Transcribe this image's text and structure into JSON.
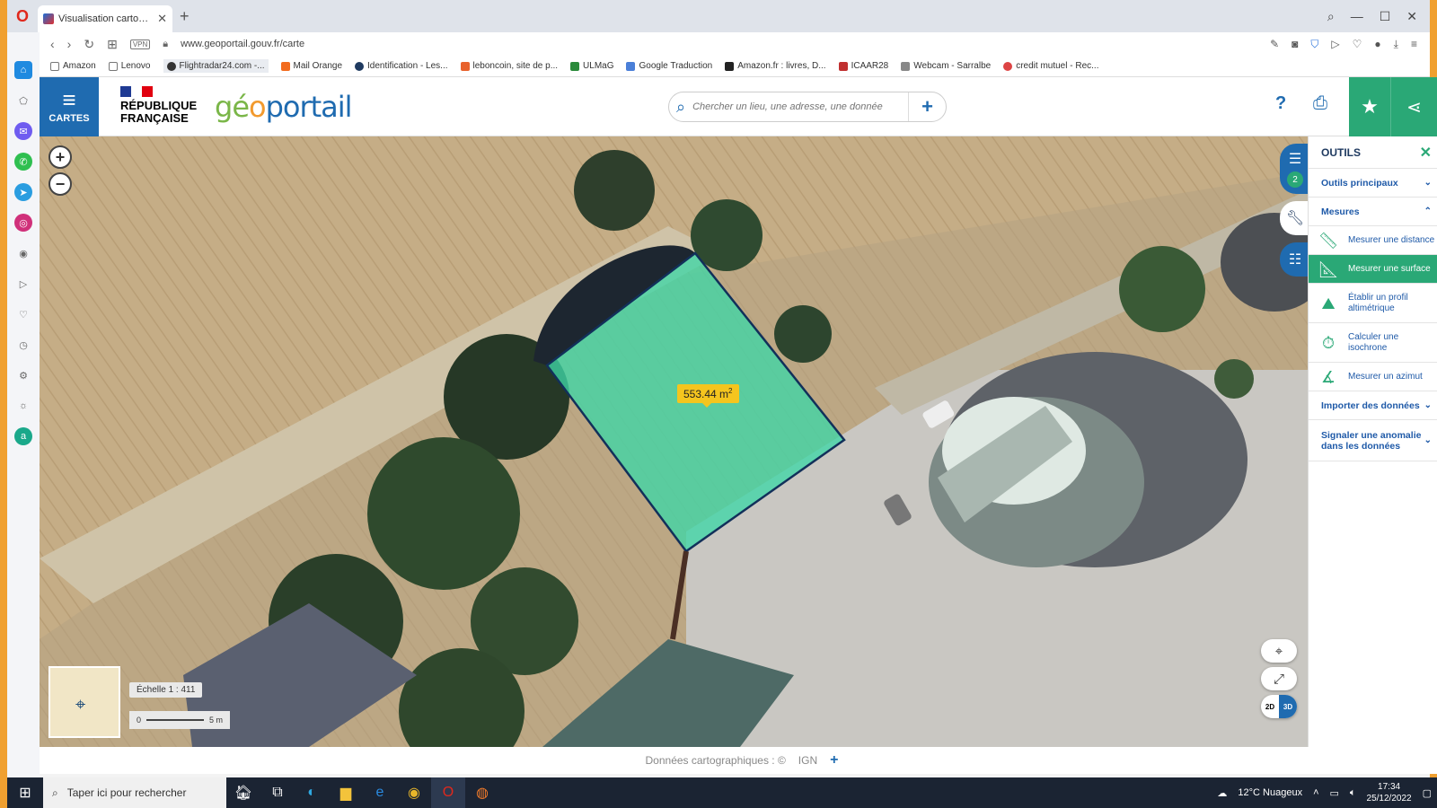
{
  "browser": {
    "tab_title": "Visualisation cartographiqu",
    "url": "www.geoportail.gouv.fr/carte",
    "vpn_label": "VPN",
    "bookmarks": [
      "Amazon",
      "Lenovo",
      "Flightradar24.com -...",
      "Mail Orange",
      "Identification - Les...",
      "leboncoin, site de p...",
      "ULMaG",
      "Google Traduction",
      "Amazon.fr : livres, D...",
      "ICAAR28",
      "Webcam - Sarralbe",
      "credit mutuel - Rec..."
    ]
  },
  "header": {
    "menu_label": "CARTES",
    "rf_line1": "RÉPUBLIQUE",
    "rf_line2": "FRANÇAISE",
    "logo_g": "g",
    "logo_e": "é",
    "logo_o": "o",
    "logo_rest": "portail",
    "search_placeholder": "Chercher un lieu, une adresse, une donnée",
    "help": "?"
  },
  "map": {
    "area_value": "553.44 m",
    "area_unit_sup": "2",
    "scale_label": "Échelle 1 : 411",
    "scale_bar_min": "0",
    "scale_bar_max": "5 m",
    "mode_2d": "2D",
    "mode_3d": "3D",
    "layers_count": "2",
    "polygon_fill": "#3fd6a6",
    "polygon_stroke": "#12305a"
  },
  "tools": {
    "title": "OUTILS",
    "sections": {
      "principaux": "Outils principaux",
      "mesures": "Mesures",
      "importer": "Importer des données",
      "signaler_line1": "Signaler une anomalie",
      "signaler_line2": "dans les données"
    },
    "items": {
      "distance": "Mesurer une distance",
      "surface": "Mesurer une surface",
      "profil_line1": "Établir un profil",
      "profil_line2": "altimétrique",
      "isochrone_line1": "Calculer une",
      "isochrone_line2": "isochrone",
      "azimut": "Mesurer un azimut"
    }
  },
  "attribution": {
    "text": "Données cartographiques : ©",
    "source": "IGN"
  },
  "taskbar": {
    "search_placeholder": "Taper ici pour rechercher",
    "weather": "12°C Nuageux",
    "time": "17:34",
    "date": "25/12/2022"
  }
}
